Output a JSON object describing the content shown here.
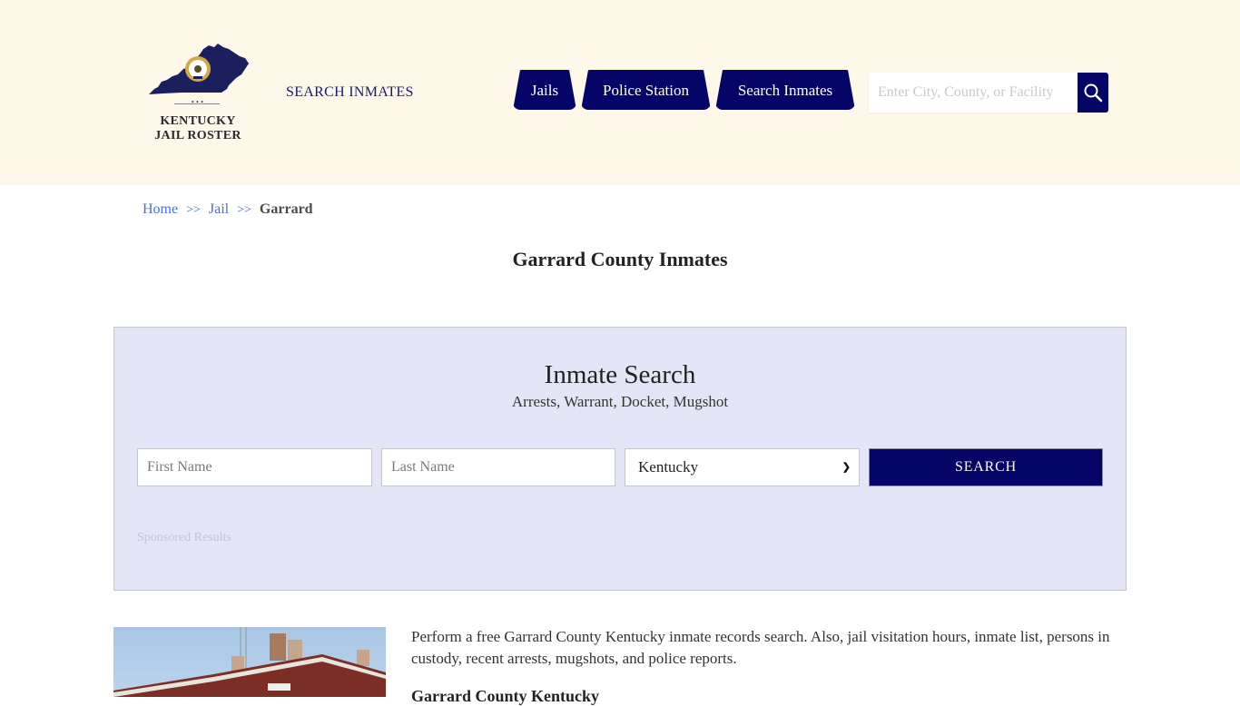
{
  "header": {
    "logo_text_line1": "KENTUCKY",
    "logo_text_line2": "JAIL ROSTER",
    "logo_dots": "•••",
    "nav_link": "SEARCH INMATES",
    "tabs": [
      {
        "label": "Jails"
      },
      {
        "label": "Police Station"
      },
      {
        "label": "Search Inmates"
      }
    ],
    "search_placeholder": "Enter City, County, or Facility",
    "brand_color": "#050568",
    "background_color": "#fef8ea"
  },
  "breadcrumb": {
    "items": [
      {
        "label": "Home"
      },
      {
        "label": "Jail"
      }
    ],
    "separator": ">>",
    "current": "Garrard"
  },
  "page_title": "Garrard County Inmates",
  "inmate_search": {
    "title": "Inmate Search",
    "subtitle": "Arrests, Warrant, Docket, Mugshot",
    "first_name_placeholder": "First Name",
    "last_name_placeholder": "Last Name",
    "state_selected": "Kentucky",
    "submit_label": "SEARCH",
    "sponsored_label": "Sponsored Results"
  },
  "content": {
    "intro": "Perform a free Garrard County Kentucky inmate records search. Also, jail visitation hours, inmate list, persons in custody, recent arrests, mugshots, and police reports.",
    "subheading": "Garrard County Kentucky"
  }
}
